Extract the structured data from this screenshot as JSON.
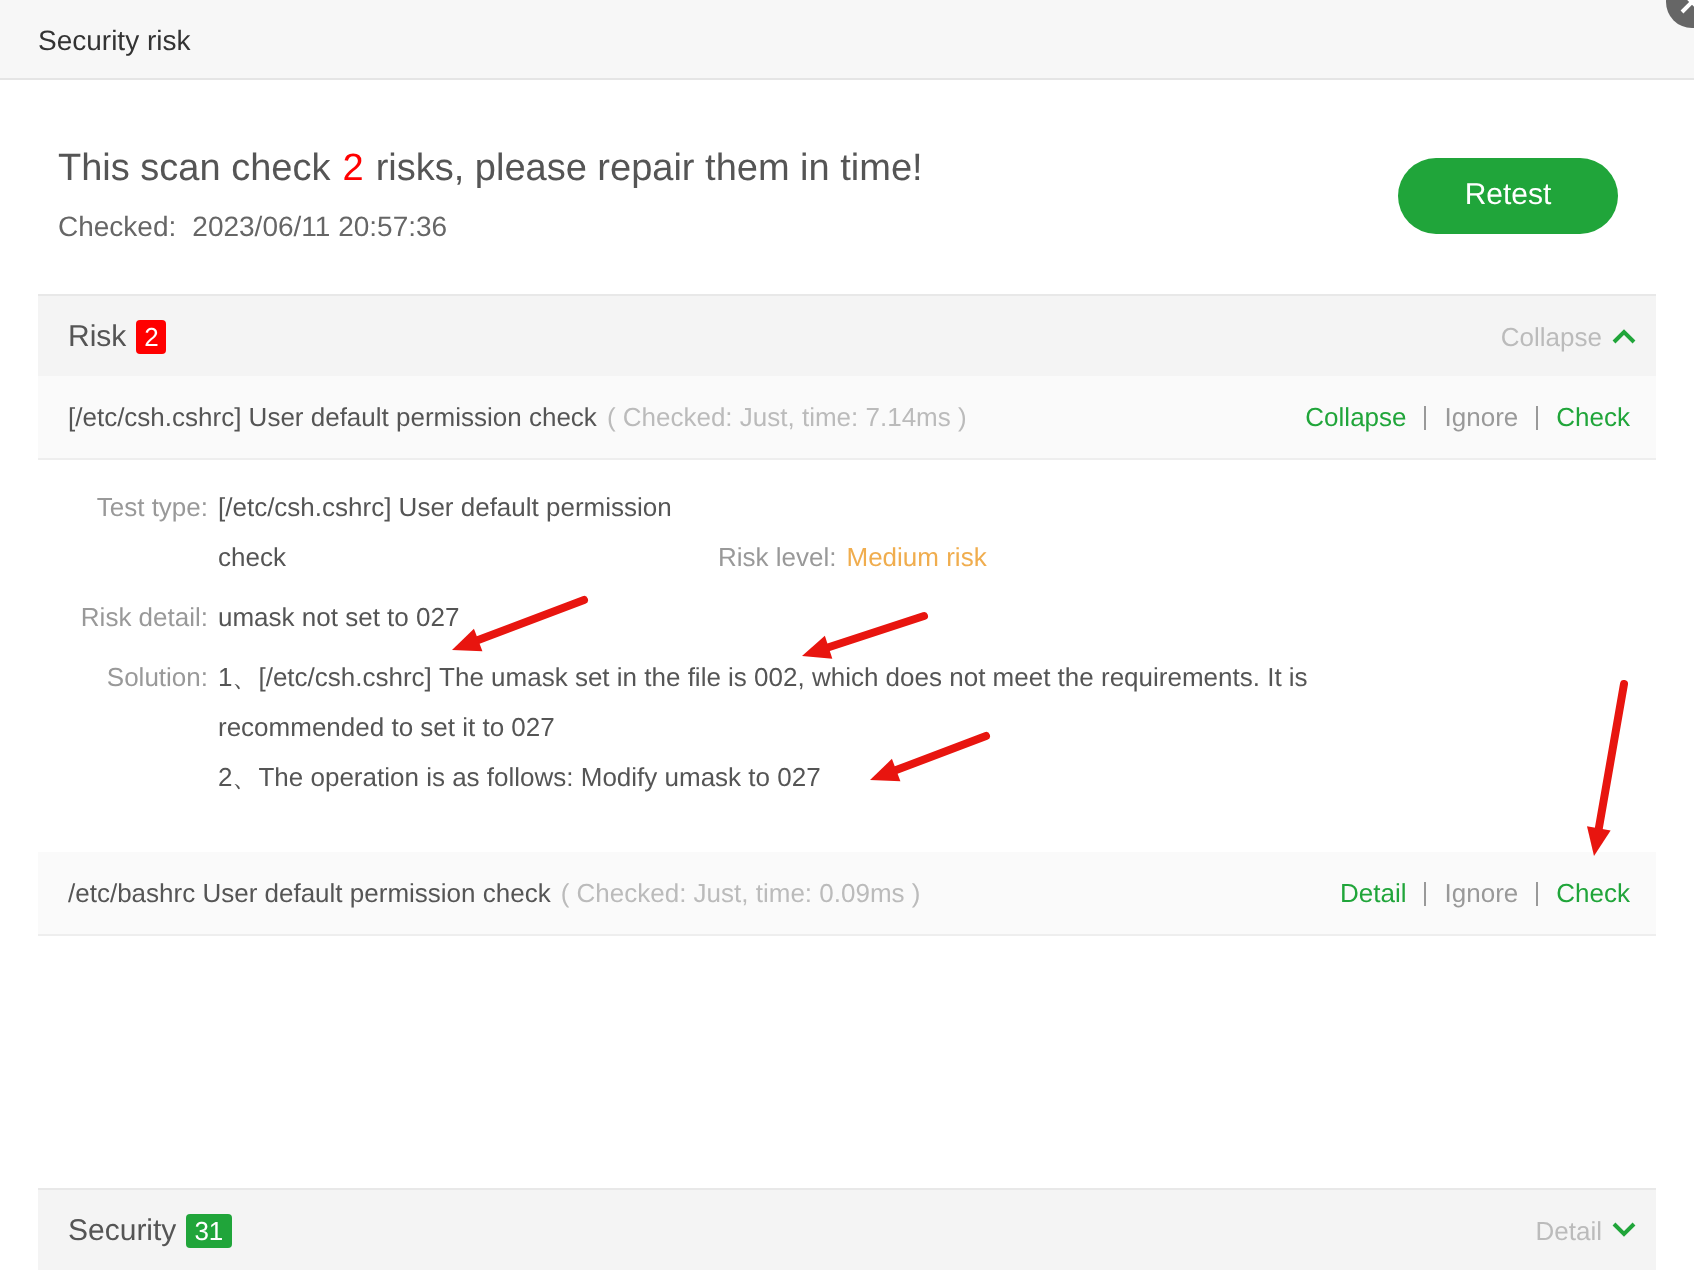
{
  "window": {
    "title": "Security risk"
  },
  "summary": {
    "text_before": "This scan check",
    "count": "2",
    "text_after": "risks, please repair them in time!",
    "checked_label": "Checked:",
    "checked_time": "2023/06/11 20:57:36",
    "retest_button": "Retest"
  },
  "sections": [
    {
      "kind": "risk",
      "title": "Risk",
      "count": "2",
      "color": "#ff0000",
      "toggle": "Collapse",
      "expanded": true,
      "items": [
        {
          "title": "[/etc/csh.cshrc] User default permission check",
          "meta": "( Checked: Just, time: 7.14ms )",
          "expanded": true,
          "actions": [
            {
              "label": "Collapse",
              "kind": "primary"
            },
            {
              "label": "Ignore",
              "kind": "secondary"
            },
            {
              "label": "Check",
              "kind": "primary"
            }
          ],
          "details": {
            "test_type_label": "Test type:",
            "test_type": "[/etc/csh.cshrc] User default permission check",
            "risk_level_label": "Risk level:",
            "risk_level": "Medium risk",
            "risk_detail_label": "Risk detail:",
            "risk_detail": "umask not set to 027",
            "solution_label": "Solution:",
            "solution": [
              "1、[/etc/csh.cshrc] The umask set in the file is 002, which does not meet the requirements. It is recommended to set it to 027",
              "2、The operation is as follows: Modify umask to 027"
            ]
          }
        },
        {
          "title": "/etc/bashrc User default permission check",
          "meta": "( Checked: Just, time: 0.09ms )",
          "expanded": false,
          "actions": [
            {
              "label": "Detail",
              "kind": "primary"
            },
            {
              "label": "Ignore",
              "kind": "secondary"
            },
            {
              "label": "Check",
              "kind": "primary"
            }
          ]
        }
      ]
    },
    {
      "kind": "security",
      "title": "Security",
      "count": "31",
      "color": "#20a53a",
      "toggle": "Detail",
      "expanded": false
    }
  ]
}
